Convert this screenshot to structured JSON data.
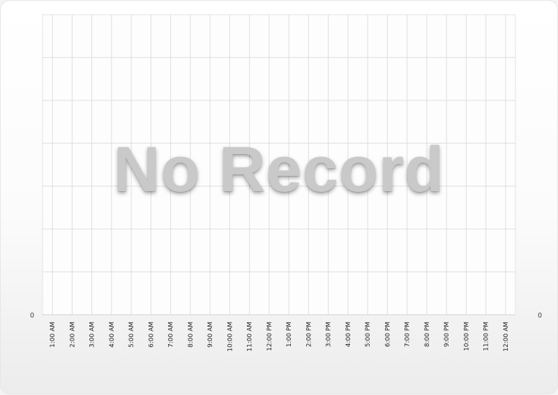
{
  "chart_data": {
    "type": "line",
    "categories": [
      "1:00 AM",
      "2:00 AM",
      "3:00 AM",
      "4:00 AM",
      "5:00 AM",
      "6:00 AM",
      "7:00 AM",
      "8:00 AM",
      "9:00 AM",
      "10:00 AM",
      "11:00 AM",
      "12:00 PM",
      "1:00 PM",
      "2:00 PM",
      "3:00 PM",
      "4:00 PM",
      "5:00 PM",
      "6:00 PM",
      "7:00 PM",
      "8:00 PM",
      "9:00 PM",
      "10:00 PM",
      "11:00 PM",
      "12:00 AM"
    ],
    "series": [],
    "title": "",
    "xlabel": "",
    "ylabel": "",
    "y_left_label": "0",
    "y_right_label": "0",
    "grid": true,
    "legend": "none"
  },
  "overlay": {
    "message": "No Record"
  },
  "colors": {
    "grid": "#dddddd",
    "message": "#c9c9c9"
  }
}
